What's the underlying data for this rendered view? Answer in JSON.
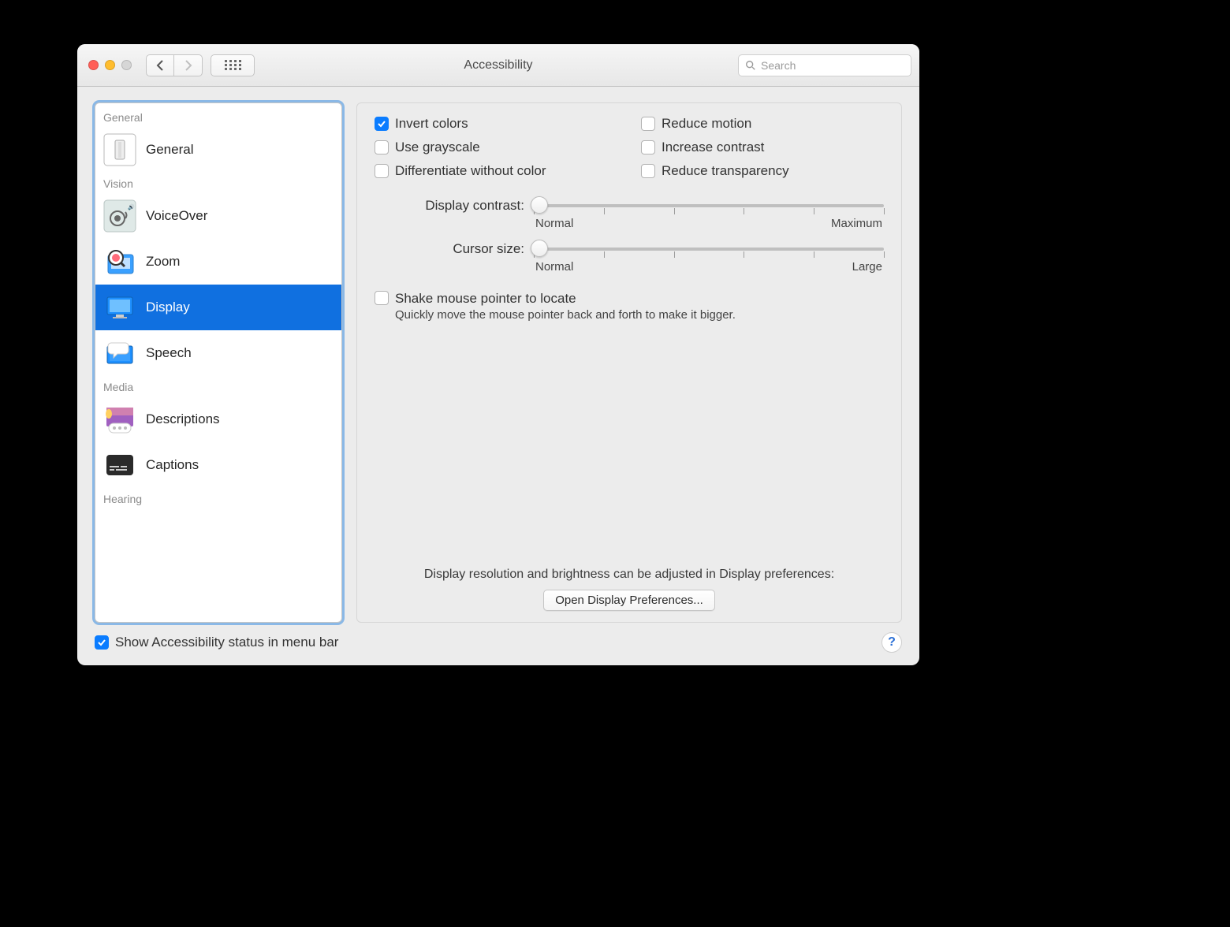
{
  "window": {
    "title": "Accessibility"
  },
  "search": {
    "placeholder": "Search",
    "value": ""
  },
  "sidebar": {
    "sections": [
      {
        "label": "General",
        "items": [
          {
            "id": "general",
            "label": "General"
          }
        ]
      },
      {
        "label": "Vision",
        "items": [
          {
            "id": "voiceover",
            "label": "VoiceOver"
          },
          {
            "id": "zoom",
            "label": "Zoom"
          },
          {
            "id": "display",
            "label": "Display",
            "selected": true
          },
          {
            "id": "speech",
            "label": "Speech"
          }
        ]
      },
      {
        "label": "Media",
        "items": [
          {
            "id": "descriptions",
            "label": "Descriptions"
          },
          {
            "id": "captions",
            "label": "Captions"
          }
        ]
      },
      {
        "label": "Hearing",
        "items": []
      }
    ]
  },
  "pane": {
    "checkboxes": {
      "invert_colors": {
        "label": "Invert colors",
        "checked": true
      },
      "reduce_motion": {
        "label": "Reduce motion",
        "checked": false
      },
      "use_grayscale": {
        "label": "Use grayscale",
        "checked": false
      },
      "increase_contrast": {
        "label": "Increase contrast",
        "checked": false
      },
      "diff_without_color": {
        "label": "Differentiate without color",
        "checked": false
      },
      "reduce_transparency": {
        "label": "Reduce transparency",
        "checked": false
      }
    },
    "display_contrast": {
      "label": "Display contrast:",
      "min_label": "Normal",
      "max_label": "Maximum",
      "value_pct": 0
    },
    "cursor_size": {
      "label": "Cursor size:",
      "min_label": "Normal",
      "max_label": "Large",
      "value_pct": 0
    },
    "shake": {
      "label": "Shake mouse pointer to locate",
      "subtext": "Quickly move the mouse pointer back and forth to make it bigger.",
      "checked": false
    },
    "bottom_note": "Display resolution and brightness can be adjusted in Display preferences:",
    "open_button": "Open Display Preferences..."
  },
  "footer": {
    "show_in_menu_bar": {
      "label": "Show Accessibility status in menu bar",
      "checked": true
    }
  }
}
